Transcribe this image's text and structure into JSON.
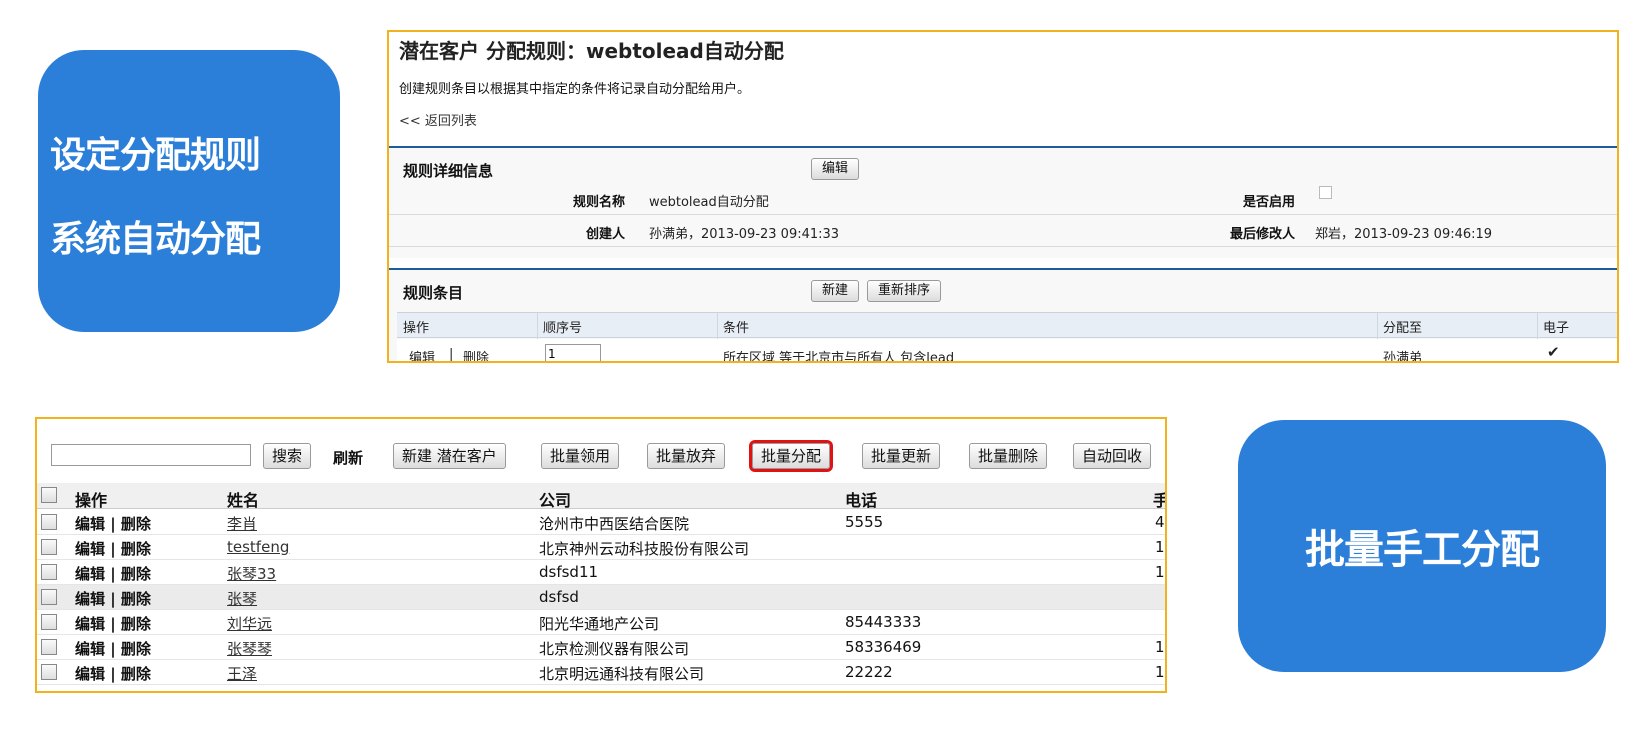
{
  "left_card": {
    "line1": "设定分配规则",
    "line2": "系统自动分配"
  },
  "right_card": {
    "text": "批量手工分配"
  },
  "rule_page": {
    "title": "潜在客户 分配规则：webtolead自动分配",
    "description": "创建规则条目以根据其中指定的条件将记录自动分配给用户。",
    "back_link": "<< 返回列表",
    "detail_section": {
      "title": "规则详细信息",
      "edit_button": "编辑",
      "rule_name_label": "规则名称",
      "rule_name_value": "webtolead自动分配",
      "active_label": "是否启用",
      "active": false,
      "created_by_label": "创建人",
      "created_by_value": "孙满弟，2013-09-23 09:41:33",
      "modified_by_label": "最后修改人",
      "modified_by_value": "郑岩，2013-09-23 09:46:19"
    },
    "items_section": {
      "title": "规则条目",
      "new_button": "新建",
      "reorder_button": "重新排序",
      "columns": [
        "操作",
        "顺序号",
        "条件",
        "分配至",
        "电子"
      ],
      "row": {
        "edit": "编辑",
        "separator": "|",
        "delete": "删除",
        "order": "1",
        "condition": "所在区域 等于北京市与所有人 包含lead",
        "assign_to": "孙满弟",
        "check": "✔"
      }
    }
  },
  "lead_list": {
    "toolbar": {
      "search_value": "",
      "search_button": "搜索",
      "refresh": "刷新",
      "new_lead_button": "新建 潜在客户",
      "batch_claim_button": "批量领用",
      "batch_abandon_button": "批量放弃",
      "batch_assign_button": "批量分配",
      "batch_update_button": "批量更新",
      "batch_delete_button": "批量删除",
      "auto_recycle_button": "自动回收"
    },
    "columns": [
      "操作",
      "姓名",
      "公司",
      "电话",
      "手"
    ],
    "action_label": "编辑 | 删除",
    "rows": [
      {
        "name": "李肖",
        "company": "沧州市中西医结合医院",
        "phone": "5555",
        "mobile": "4"
      },
      {
        "name": "testfeng",
        "company": "北京神州云动科技股份有限公司",
        "phone": "",
        "mobile": "1"
      },
      {
        "name": "张琴33",
        "company": "dsfsd11",
        "phone": "",
        "mobile": "1"
      },
      {
        "name": "张琴",
        "company": "dsfsd",
        "phone": "",
        "mobile": ""
      },
      {
        "name": "刘华远",
        "company": "阳光华通地产公司",
        "phone": "85443333",
        "mobile": ""
      },
      {
        "name": "张琴琴",
        "company": "北京检测仪器有限公司",
        "phone": "58336469",
        "mobile": "1"
      },
      {
        "name": "王泽",
        "company": "北京明远通科技有限公司",
        "phone": "22222",
        "mobile": "1"
      }
    ]
  },
  "colors": {
    "card_blue": "#2b7fd8",
    "panel_border": "#f2b21c",
    "highlight_red": "#e01212",
    "link_blue": "#1a5fb4"
  }
}
